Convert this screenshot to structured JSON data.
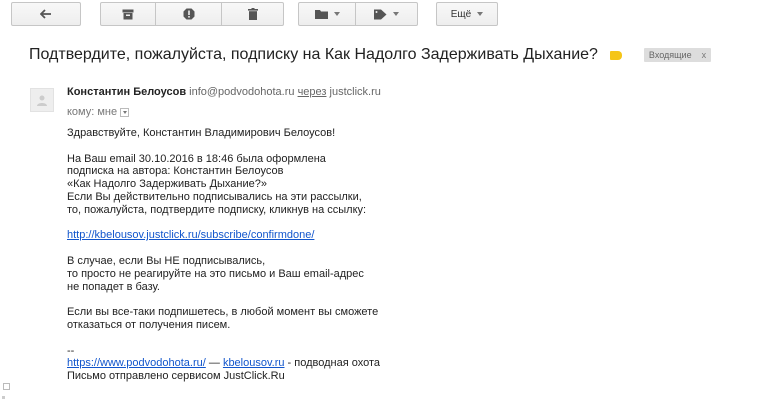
{
  "toolbar": {
    "more_label": "Ещё"
  },
  "subject": {
    "text": "Подтвердите, пожалуйста, подписку на Как Надолго Задерживать Дыхание?",
    "label_color": "#f5c518",
    "badge_label": "Входящие",
    "badge_close": "x"
  },
  "message": {
    "sender_name": "Константин Белоусов",
    "sender_email": "info@podvodohota.ru",
    "via_label": "через",
    "via_domain": "justclick.ru",
    "to_label": "кому: мне",
    "body": {
      "greeting": "Здравствуйте, Константин Владимирович Белоусов!",
      "p1_line1": "На Ваш email 30.10.2016 в 18:46 была оформлена",
      "p1_line2": "подписка на автора: Константин Белоусов",
      "p1_line3": "«Как Надолго Задерживать Дыхание?»",
      "p1_line4": "Если Вы действительно подписывались на эти рассылки,",
      "p1_line5": "то, пожалуйста, подтвердите подписку, кликнув на ссылку:",
      "confirm_link": "http://kbelousov.justclick.ru/subscribe/confirmdone/",
      "p2_line1": "В случае, если Вы НЕ подписывались,",
      "p2_line2": "то просто не реагируйте на это письмо и Ваш email-адрес",
      "p2_line3": "не попадет в базу.",
      "p3_line1": "Если вы все-таки подпишетесь, в любой момент вы сможете",
      "p3_line2": "отказаться от получения писем.",
      "signature_sep": "--",
      "sig_link1": "https://www.podvodohota.ru/",
      "sig_dash": " — ",
      "sig_link2": "kbelousov.ru",
      "sig_suffix": " - подводная охота",
      "sig_line2": "Письмо отправлено сервисом JustClick.Ru"
    }
  },
  "icons": {
    "back": "arrow-left-icon",
    "archive": "archive-icon",
    "spam": "report-spam-icon",
    "delete": "trash-icon",
    "move": "folder-icon",
    "labels": "tag-icon"
  },
  "colors": {
    "link": "#1155cc",
    "badge_bg": "#dddddd"
  }
}
